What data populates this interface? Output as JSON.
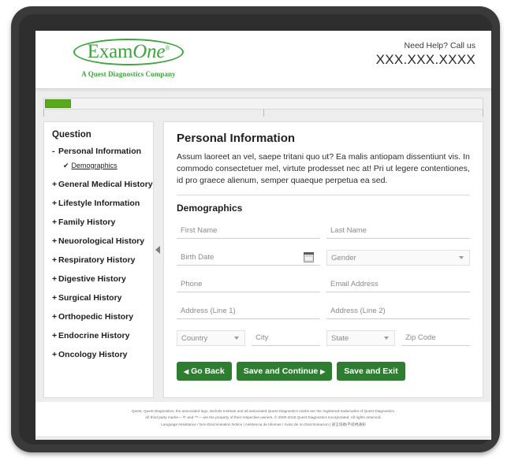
{
  "header": {
    "logo_main": "Exam",
    "logo_main_italic": "One",
    "logo_tm": "®",
    "logo_sub": "A Quest Diagnostics Company",
    "help_label": "Need Help? Call us",
    "help_number": "XXX.XXX.XXXX"
  },
  "progress": {
    "percent": 6,
    "tick_positions": [
      0,
      50,
      100
    ]
  },
  "sidebar": {
    "title": "Question",
    "items": [
      {
        "sign": "-",
        "label": "Personal Information",
        "expanded": true
      },
      {
        "sign": "+",
        "label": "General Medical History",
        "expanded": false
      },
      {
        "sign": "+",
        "label": "Lifestyle Information",
        "expanded": false
      },
      {
        "sign": "+",
        "label": "Family History",
        "expanded": false
      },
      {
        "sign": "+",
        "label": "Neuorological History",
        "expanded": false
      },
      {
        "sign": "+",
        "label": "Respiratory History",
        "expanded": false
      },
      {
        "sign": "+",
        "label": "Digestive History",
        "expanded": false
      },
      {
        "sign": "+",
        "label": "Surgical History",
        "expanded": false
      },
      {
        "sign": "+",
        "label": "Orthopedic History",
        "expanded": false
      },
      {
        "sign": "+",
        "label": "Endocrine History",
        "expanded": false
      },
      {
        "sign": "+",
        "label": "Oncology History",
        "expanded": false
      }
    ],
    "sub_item": {
      "check": "✔",
      "label": "Demographics"
    }
  },
  "main": {
    "title": "Personal Information",
    "intro": "Assum laoreet an vel, saepe tritani quo ut? Ea malis antiopam dissentiunt vis. In commodo consectetuer mel, virtute prodesset nec at! Pri ut legere contentiones, id pro graece alienum, semper quaeque perpetua ea sed.",
    "section_title": "Demographics",
    "fields": {
      "first_name": "First Name",
      "last_name": "Last Name",
      "birth_date": "Birth Date",
      "gender": "Gender",
      "phone": "Phone",
      "email": "Email Address",
      "address1": "Address (Line 1)",
      "address2": "Address (Line 2)",
      "country": "Country",
      "city": "City",
      "state": "State",
      "zip": "Zip Code"
    },
    "buttons": {
      "back": "Go Back",
      "back_arrow": "◀",
      "continue": "Save and Continue",
      "continue_arrow": "▶",
      "exit": "Save and Exit"
    }
  },
  "footer": {
    "line1": "Quest, Quest Diagnostics, the associated logo, Nichols Institute and all associated Quest Diagnostics marks are the registered trademarks of Quest Diagnostics.",
    "line2": "All third party marks— ®' and ™— are the property of their respective owners. © 2000-2018 Quest Diagnostics Incorporated. All rights reserved.",
    "line3": "Language Assistance / Non-Discrimination Notice | Asistencia de Idiomas / Aviso de no Discriminacion | 語言協助/不歧視通知"
  },
  "colors": {
    "brand_green": "#3da53d",
    "button_green": "#2f7d31",
    "progress_green": "#5aa81e",
    "bezel": "#3a3a3a"
  }
}
